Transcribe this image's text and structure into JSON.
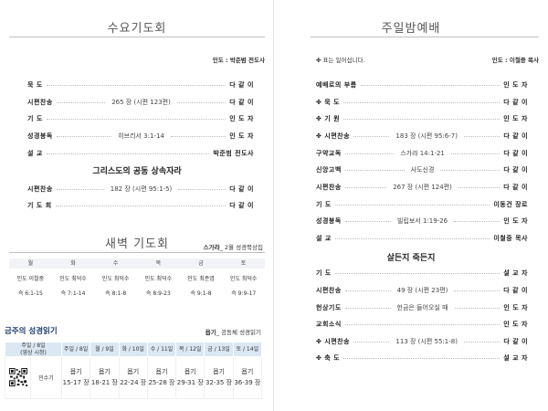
{
  "wednesday": {
    "title": "수요기도회",
    "preacher": "인도 : 박준범 전도사",
    "rows": [
      {
        "label": "묵 도",
        "mid": "",
        "right": "다 같 이"
      },
      {
        "label": "시편찬송",
        "mid": "265 장 (시편 123편)",
        "right": "다 같 이"
      },
      {
        "label": "기 도",
        "mid": "",
        "right": "인 도 자"
      },
      {
        "label": "성경봉독",
        "mid": "히브리서 3:1-14",
        "right": "인 도 자"
      },
      {
        "label": "설 교",
        "mid": "",
        "right": "박준범 전도사"
      }
    ],
    "subheading": "그리스도의 공동 상속자라",
    "rows2": [
      {
        "label": "시편찬송",
        "mid": "182 장 (시편 95:1-5)",
        "right": "다 같 이"
      },
      {
        "label": "기 도 회",
        "mid": "",
        "right": "다 같 이"
      }
    ]
  },
  "dawn": {
    "title": "새벽 기도회",
    "book": "스가랴",
    "book_note": "_ 2월 성경묵상집",
    "days": [
      "월",
      "화",
      "수",
      "목",
      "금",
      "토"
    ],
    "leaders": [
      "인도 이철중",
      "인도 최덕수",
      "인도 최덕수",
      "인도 최덕수",
      "인도 최준엽",
      "인도 최덕수"
    ],
    "passages": [
      "슥 6:1-15",
      "슥 7:1-14",
      "슥 8:1-8",
      "슥 8:9-23",
      "슥 9:1-8",
      "슥 9:9-17"
    ]
  },
  "bible": {
    "title": "금주의 성경읽기",
    "book": "욥기",
    "book_note": "_ 공동체 성경읽기",
    "header_first": "주일 / 8일\n(영상 시청)",
    "dates": [
      "주일 / 8일",
      "월 / 9일",
      "화 / 10일",
      "수 / 11일",
      "목 / 12일",
      "금 / 13일",
      "토 / 14일"
    ],
    "row_label": "민수기",
    "readings": [
      [
        "욥기",
        "15-17 장"
      ],
      [
        "욥기",
        "18-21 장"
      ],
      [
        "욥기",
        "22-24 장"
      ],
      [
        "욥기",
        "25-28 장"
      ],
      [
        "욥기",
        "29-31 장"
      ],
      [
        "욥기",
        "32-35 장"
      ],
      [
        "욥기",
        "36-39 장"
      ]
    ]
  },
  "sunday": {
    "title": "주일밤예배",
    "note": "✤ 표는 일어섭니다.",
    "preacher": "인도 : 이철중 목사",
    "rows": [
      {
        "label": "예배로의 부름",
        "mid": "",
        "right": "인 도 자"
      },
      {
        "label": "✤ 묵 도",
        "mid": "",
        "right": "다 같 이"
      },
      {
        "label": "✤ 기 원",
        "mid": "",
        "right": "인 도 자"
      },
      {
        "label": "✤ 시편찬송",
        "mid": "183 장 (시편 95:6-7)",
        "right": "다 같 이"
      },
      {
        "label": "구약교독",
        "mid": "스가랴 14:1-21",
        "right": "다 같 이"
      },
      {
        "label": "신앙고백",
        "mid": "사도신경",
        "right": "다 같 이"
      },
      {
        "label": "시편찬송",
        "mid": "267 장 (시편 124편)",
        "right": "다 같 이"
      },
      {
        "label": "기 도",
        "mid": "",
        "right": "이동건 장로"
      },
      {
        "label": "성경봉독",
        "mid": "빌립보서 1:19-26",
        "right": "인 도 자"
      },
      {
        "label": "설 교",
        "mid": "",
        "right": "이철중 목사"
      }
    ],
    "subheading": "살든지 죽든지",
    "rows2": [
      {
        "label": "기 도",
        "mid": "",
        "right": "설 교 자"
      },
      {
        "label": "시편찬송",
        "mid": "49 장 (시편 23편)",
        "right": "다 같 이"
      },
      {
        "label": "헌상기도",
        "mid": "헌금은 들어오실 때",
        "right": "인 도 자"
      },
      {
        "label": "교회소식",
        "mid": "",
        "right": "인 도 자"
      },
      {
        "label": "✤ 시편찬송",
        "mid": "113 장 (시편 55:1-8)",
        "right": "다 같 이"
      },
      {
        "label": "✤ 축 도",
        "mid": "",
        "right": "설 교 자"
      }
    ]
  }
}
